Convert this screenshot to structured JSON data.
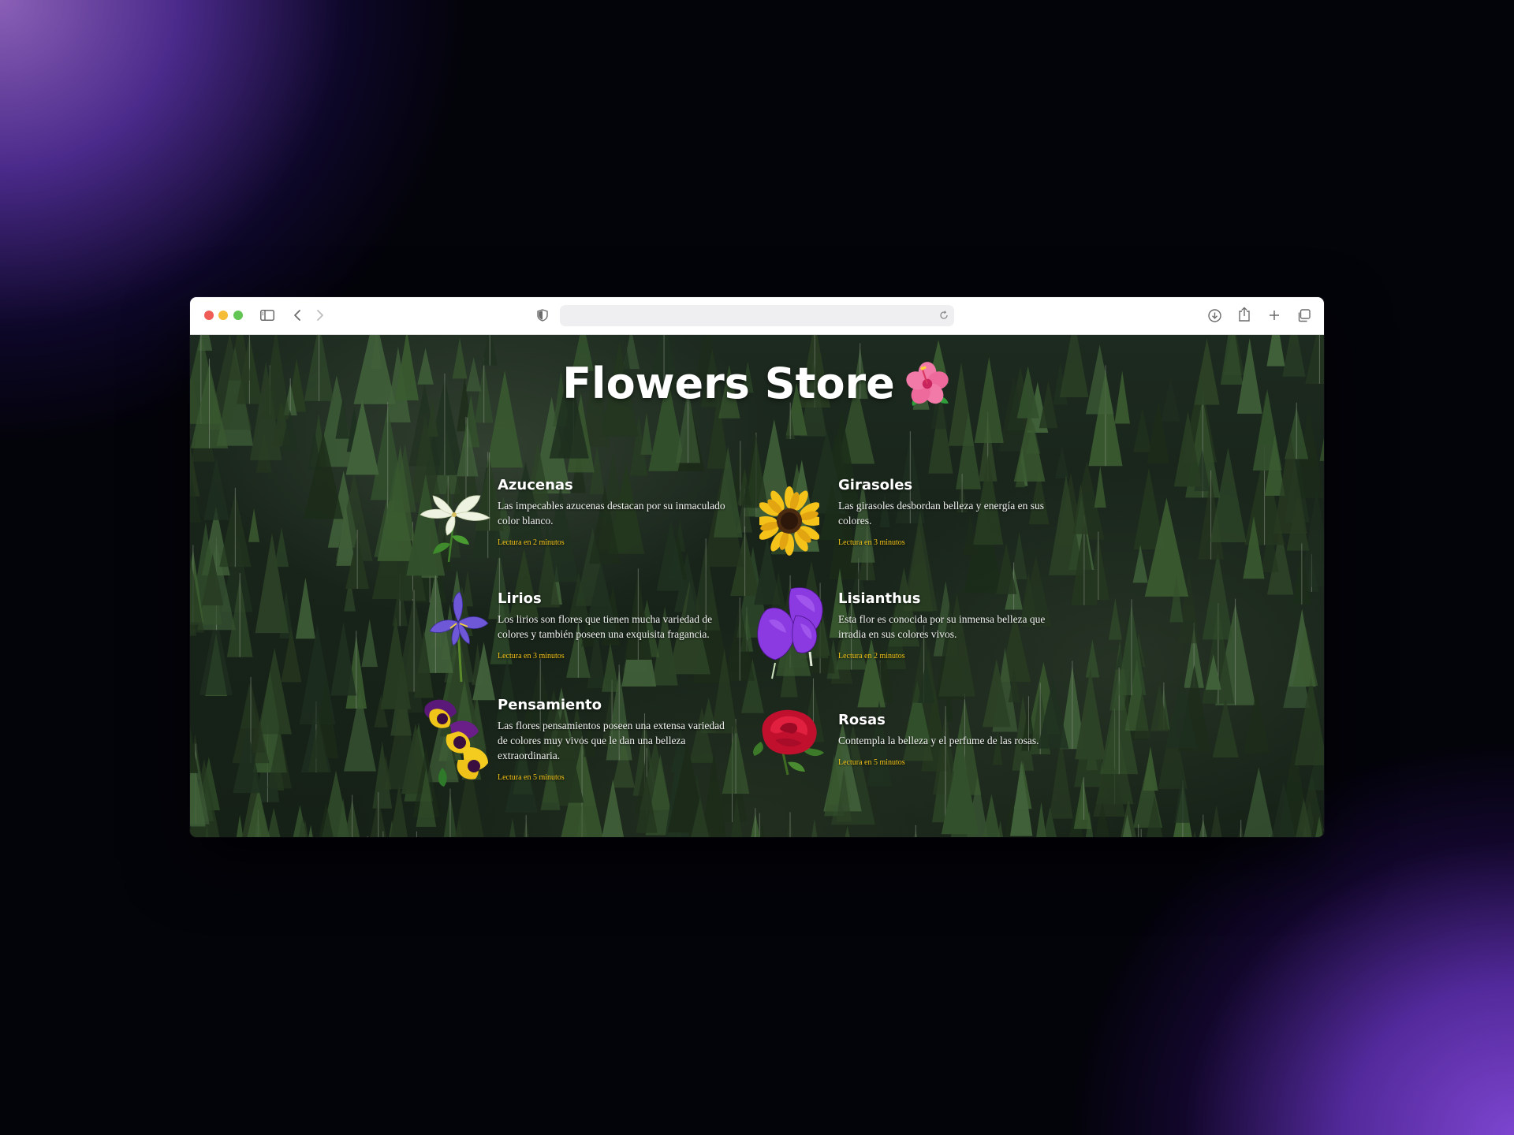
{
  "browser": {
    "address_value": "",
    "icons": [
      "sidebar-icon",
      "back-icon",
      "forward-icon",
      "shield-icon",
      "reload-icon",
      "download-icon",
      "share-icon",
      "new-tab-icon",
      "tabs-overview-icon"
    ]
  },
  "page": {
    "title": "Flowers Store",
    "title_emoji": "🌺"
  },
  "cards": [
    {
      "title": "Azucenas",
      "description": "Las impecables azucenas destacan por su inmaculado color blanco.",
      "read": "Lectura en 2 minutos",
      "icon": "white-lily-icon"
    },
    {
      "title": "Girasoles",
      "description": "Las girasoles desbordan belleza y energía en sus colores.",
      "read": "Lectura en 3 minutos",
      "icon": "sunflower-icon"
    },
    {
      "title": "Lirios",
      "description": "Los lirios son flores que tienen mucha variedad de colores y también poseen una exquisita fragancia.",
      "read": "Lectura en 3 minutos",
      "icon": "iris-icon"
    },
    {
      "title": "Lisianthus",
      "description": "Esta flor es conocida por su inmensa belleza que irradia en sus colores vivos.",
      "read": "Lectura en 2 minutos",
      "icon": "lisianthus-icon"
    },
    {
      "title": "Pensamiento",
      "description": "Las flores pensamientos poseen una extensa variedad de colores muy vivos que le dan una belleza extraordinaria.",
      "read": "Lectura en 5 minutos",
      "icon": "pansy-icon"
    },
    {
      "title": "Rosas",
      "description": "Contempla la belleza y el perfume de las rosas.",
      "read": "Lectura en 5 minutos",
      "icon": "rose-icon"
    }
  ]
}
